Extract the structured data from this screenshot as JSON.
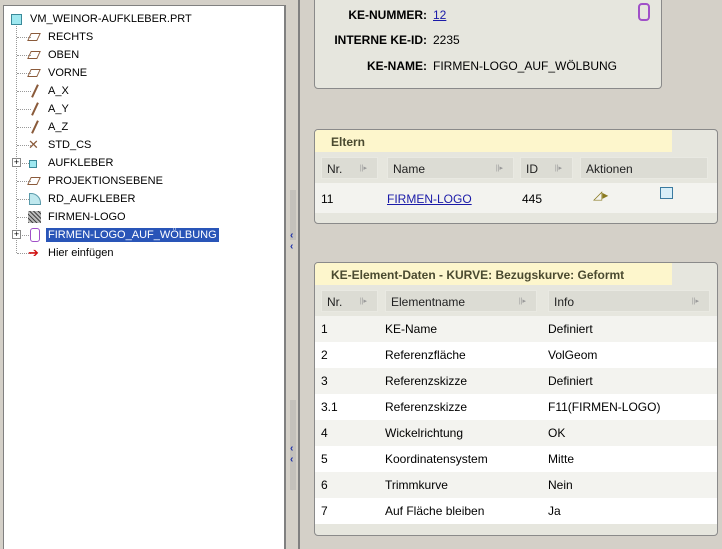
{
  "tree": {
    "root": "VM_WEINOR-AUFKLEBER.PRT",
    "items": [
      {
        "label": "RECHTS",
        "icon": "plane-icon"
      },
      {
        "label": "OBEN",
        "icon": "plane-icon"
      },
      {
        "label": "VORNE",
        "icon": "plane-icon"
      },
      {
        "label": "A_X",
        "icon": "axis-icon"
      },
      {
        "label": "A_Y",
        "icon": "axis-icon"
      },
      {
        "label": "A_Z",
        "icon": "axis-icon"
      },
      {
        "label": "STD_CS",
        "icon": "coordsys-icon"
      },
      {
        "label": "AUFKLEBER",
        "icon": "feature-icon",
        "expandable": true
      },
      {
        "label": "PROJEKTIONSEBENE",
        "icon": "plane-icon"
      },
      {
        "label": "RD_AUFKLEBER",
        "icon": "round-icon"
      },
      {
        "label": "FIRMEN-LOGO",
        "icon": "sketch-icon"
      },
      {
        "label": "FIRMEN-LOGO_AUF_WÖLBUNG",
        "icon": "wrap-curve-icon",
        "expandable": true,
        "selected": true
      },
      {
        "label": "Hier einfügen",
        "icon": "insert-arrow-icon"
      }
    ]
  },
  "info": {
    "ke_nummer_label": "KE-NUMMER:",
    "ke_nummer": "12",
    "ke_id_label": "INTERNE KE-ID:",
    "ke_id": "2235",
    "ke_name_label": "KE-NAME:",
    "ke_name": "FIRMEN-LOGO_AUF_WÖLBUNG"
  },
  "eltern": {
    "title": "Eltern",
    "columns": [
      "Nr.",
      "Name",
      "ID",
      "Aktionen"
    ],
    "rows": [
      {
        "nr": "11",
        "name": "FIRMEN-LOGO",
        "id": "445"
      }
    ]
  },
  "elements": {
    "title": "KE-Element-Daten - KURVE: Bezugskurve: Geformt",
    "columns": [
      "Nr.",
      "Elementname",
      "Info"
    ],
    "rows": [
      [
        "1",
        "KE-Name",
        "Definiert"
      ],
      [
        "2",
        "Referenzfläche",
        "VolGeom"
      ],
      [
        "3",
        "Referenzskizze",
        "Definiert"
      ],
      [
        "3.1",
        "Referenzskizze",
        "F11(FIRMEN-LOGO)"
      ],
      [
        "4",
        "Wickelrichtung",
        "OK"
      ],
      [
        "5",
        "Koordinatensystem",
        "Mitte"
      ],
      [
        "6",
        "Trimmkurve",
        "Nein"
      ],
      [
        "7",
        "Auf Fläche bleiben",
        "Ja"
      ]
    ]
  }
}
